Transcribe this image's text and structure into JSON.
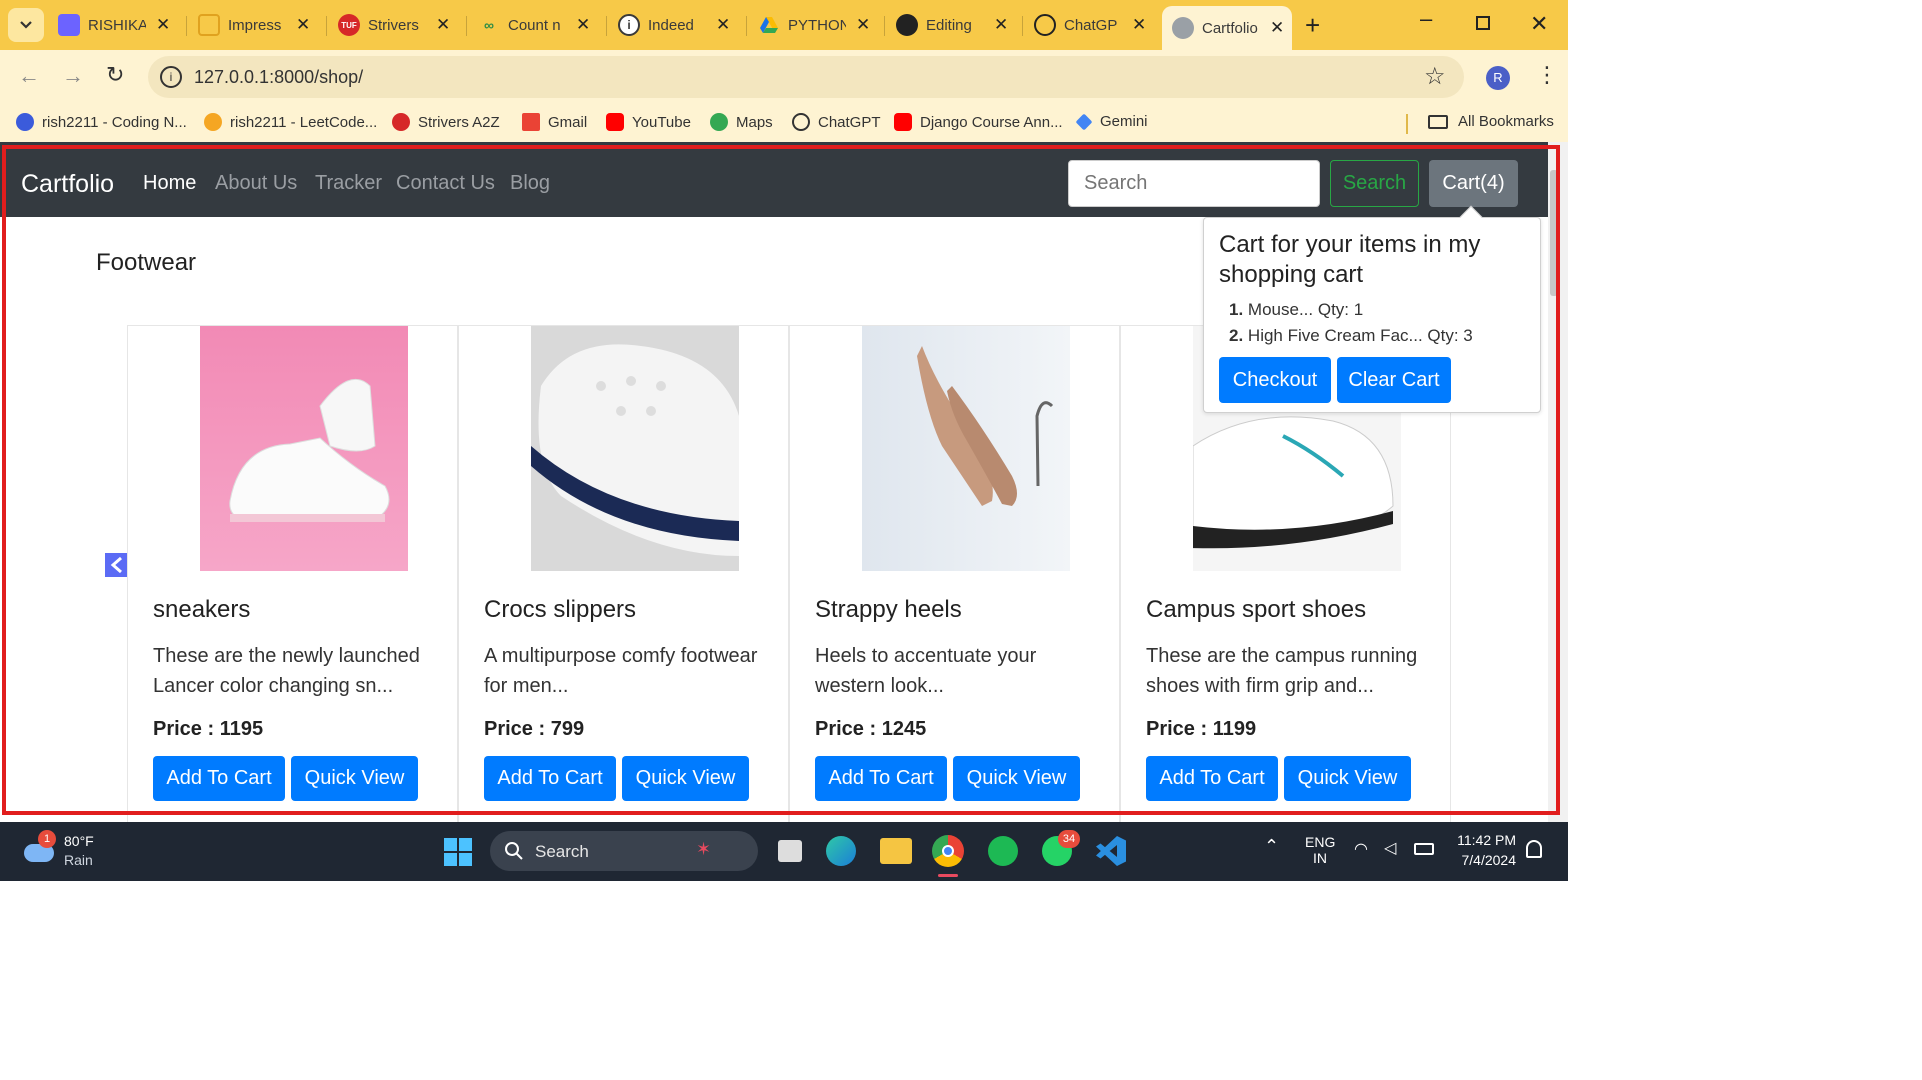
{
  "browser": {
    "tabs": [
      {
        "title": "RISHIKA",
        "icon": "printer-icon",
        "color": "#6c63ff"
      },
      {
        "title": "Impress",
        "icon": "pencil-icon",
        "color": "#e0a21f"
      },
      {
        "title": "Strivers",
        "icon": "tuf-icon",
        "color": "#d62828"
      },
      {
        "title": "Count n",
        "icon": "gfg-icon",
        "color": "#2f8d46"
      },
      {
        "title": "Indeed",
        "icon": "info-icon",
        "color": "#3a3a3a"
      },
      {
        "title": "PYTHON",
        "icon": "drive-icon",
        "color": "#1a73e8"
      },
      {
        "title": "Editing",
        "icon": "github-icon",
        "color": "#222222"
      },
      {
        "title": "ChatGP",
        "icon": "openai-icon",
        "color": "#222222"
      },
      {
        "title": "Cartfolio",
        "icon": "globe-icon",
        "color": "#7a7a7a"
      }
    ],
    "url": "127.0.0.1:8000/shop/",
    "profile_initial": "R",
    "bookmarks": [
      {
        "label": "rish2211 - Coding N...",
        "color": "#3b5bdb"
      },
      {
        "label": "rish2211 - LeetCode...",
        "color": "#f5a623"
      },
      {
        "label": "Strivers A2Z",
        "color": "#d62828"
      },
      {
        "label": "Gmail",
        "color": "#ea4335"
      },
      {
        "label": "YouTube",
        "color": "#ff0000"
      },
      {
        "label": "Maps",
        "color": "#34a853"
      },
      {
        "label": "ChatGPT",
        "color": "#333333"
      },
      {
        "label": "Django Course Ann...",
        "color": "#ff0000"
      },
      {
        "label": "Gemini",
        "color": "#4285f4"
      }
    ],
    "all_bookmarks": "All Bookmarks"
  },
  "site": {
    "brand": "Cartfolio",
    "nav": [
      "Home",
      "About Us",
      "Tracker",
      "Contact Us",
      "Blog"
    ],
    "search_placeholder": "Search",
    "search_button": "Search",
    "cart_button": "Cart(4)",
    "category": "Footwear"
  },
  "cart_popover": {
    "title": "Cart for your items in my shopping cart",
    "items": [
      {
        "num": "1.",
        "text": "Mouse... Qty: 1"
      },
      {
        "num": "2.",
        "text": "High Five Cream Fac... Qty: 3"
      }
    ],
    "checkout": "Checkout",
    "clear": "Clear Cart"
  },
  "products": [
    {
      "title": "sneakers",
      "desc": "These are the newly launched Lancer color changing sn...",
      "price": "Price : 1195",
      "add": "Add To Cart",
      "view": "Quick View"
    },
    {
      "title": "Crocs slippers",
      "desc": "A multipurpose comfy footwear for men...",
      "price": "Price : 799",
      "add": "Add To Cart",
      "view": "Quick View"
    },
    {
      "title": "Strappy heels",
      "desc": "Heels to accentuate your western look...",
      "price": "Price : 1245",
      "add": "Add To Cart",
      "view": "Quick View"
    },
    {
      "title": "Campus sport shoes",
      "desc": "These are the campus running shoes with firm grip and...",
      "price": "Price : 1199",
      "add": "Add To Cart",
      "view": "Quick View"
    }
  ],
  "taskbar": {
    "weather_badge": "1",
    "temp": "80°F",
    "condition": "Rain",
    "search": "Search",
    "whatsapp_badge": "34",
    "lang1": "ENG",
    "lang2": "IN",
    "time": "11:42 PM",
    "date": "7/4/2024"
  }
}
